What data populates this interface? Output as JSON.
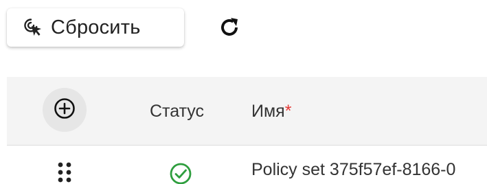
{
  "toolbar": {
    "reset_label": "Сбросить",
    "reset_icon": "cursor-click-icon",
    "refresh_icon": "refresh-icon"
  },
  "table": {
    "add_icon": "plus-circle-icon",
    "columns": {
      "status": "Статус",
      "name": "Имя",
      "name_required_mark": "*"
    },
    "rows": [
      {
        "drag_icon": "drag-handle-icon",
        "status_icon": "check-circle-icon",
        "name": "Policy set 375f57ef-8166-0"
      }
    ]
  },
  "colors": {
    "status_ok": "#2e9e3e",
    "required": "#e53935",
    "header_bg": "#f4f4f4"
  }
}
